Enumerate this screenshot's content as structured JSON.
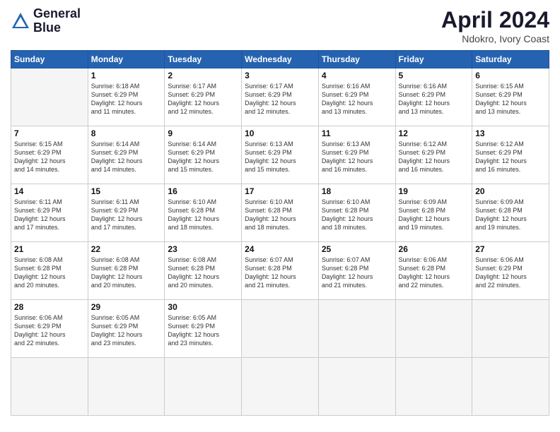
{
  "logo": {
    "line1": "General",
    "line2": "Blue"
  },
  "title": "April 2024",
  "location": "Ndokro, Ivory Coast",
  "days": [
    "Sunday",
    "Monday",
    "Tuesday",
    "Wednesday",
    "Thursday",
    "Friday",
    "Saturday"
  ],
  "cells": [
    {
      "date": "",
      "info": ""
    },
    {
      "date": "1",
      "info": "Sunrise: 6:18 AM\nSunset: 6:29 PM\nDaylight: 12 hours\nand 11 minutes."
    },
    {
      "date": "2",
      "info": "Sunrise: 6:17 AM\nSunset: 6:29 PM\nDaylight: 12 hours\nand 12 minutes."
    },
    {
      "date": "3",
      "info": "Sunrise: 6:17 AM\nSunset: 6:29 PM\nDaylight: 12 hours\nand 12 minutes."
    },
    {
      "date": "4",
      "info": "Sunrise: 6:16 AM\nSunset: 6:29 PM\nDaylight: 12 hours\nand 13 minutes."
    },
    {
      "date": "5",
      "info": "Sunrise: 6:16 AM\nSunset: 6:29 PM\nDaylight: 12 hours\nand 13 minutes."
    },
    {
      "date": "6",
      "info": "Sunrise: 6:15 AM\nSunset: 6:29 PM\nDaylight: 12 hours\nand 13 minutes."
    },
    {
      "date": "7",
      "info": "Sunrise: 6:15 AM\nSunset: 6:29 PM\nDaylight: 12 hours\nand 14 minutes."
    },
    {
      "date": "8",
      "info": "Sunrise: 6:14 AM\nSunset: 6:29 PM\nDaylight: 12 hours\nand 14 minutes."
    },
    {
      "date": "9",
      "info": "Sunrise: 6:14 AM\nSunset: 6:29 PM\nDaylight: 12 hours\nand 15 minutes."
    },
    {
      "date": "10",
      "info": "Sunrise: 6:13 AM\nSunset: 6:29 PM\nDaylight: 12 hours\nand 15 minutes."
    },
    {
      "date": "11",
      "info": "Sunrise: 6:13 AM\nSunset: 6:29 PM\nDaylight: 12 hours\nand 16 minutes."
    },
    {
      "date": "12",
      "info": "Sunrise: 6:12 AM\nSunset: 6:29 PM\nDaylight: 12 hours\nand 16 minutes."
    },
    {
      "date": "13",
      "info": "Sunrise: 6:12 AM\nSunset: 6:29 PM\nDaylight: 12 hours\nand 16 minutes."
    },
    {
      "date": "14",
      "info": "Sunrise: 6:11 AM\nSunset: 6:29 PM\nDaylight: 12 hours\nand 17 minutes."
    },
    {
      "date": "15",
      "info": "Sunrise: 6:11 AM\nSunset: 6:29 PM\nDaylight: 12 hours\nand 17 minutes."
    },
    {
      "date": "16",
      "info": "Sunrise: 6:10 AM\nSunset: 6:28 PM\nDaylight: 12 hours\nand 18 minutes."
    },
    {
      "date": "17",
      "info": "Sunrise: 6:10 AM\nSunset: 6:28 PM\nDaylight: 12 hours\nand 18 minutes."
    },
    {
      "date": "18",
      "info": "Sunrise: 6:10 AM\nSunset: 6:28 PM\nDaylight: 12 hours\nand 18 minutes."
    },
    {
      "date": "19",
      "info": "Sunrise: 6:09 AM\nSunset: 6:28 PM\nDaylight: 12 hours\nand 19 minutes."
    },
    {
      "date": "20",
      "info": "Sunrise: 6:09 AM\nSunset: 6:28 PM\nDaylight: 12 hours\nand 19 minutes."
    },
    {
      "date": "21",
      "info": "Sunrise: 6:08 AM\nSunset: 6:28 PM\nDaylight: 12 hours\nand 20 minutes."
    },
    {
      "date": "22",
      "info": "Sunrise: 6:08 AM\nSunset: 6:28 PM\nDaylight: 12 hours\nand 20 minutes."
    },
    {
      "date": "23",
      "info": "Sunrise: 6:08 AM\nSunset: 6:28 PM\nDaylight: 12 hours\nand 20 minutes."
    },
    {
      "date": "24",
      "info": "Sunrise: 6:07 AM\nSunset: 6:28 PM\nDaylight: 12 hours\nand 21 minutes."
    },
    {
      "date": "25",
      "info": "Sunrise: 6:07 AM\nSunset: 6:28 PM\nDaylight: 12 hours\nand 21 minutes."
    },
    {
      "date": "26",
      "info": "Sunrise: 6:06 AM\nSunset: 6:28 PM\nDaylight: 12 hours\nand 22 minutes."
    },
    {
      "date": "27",
      "info": "Sunrise: 6:06 AM\nSunset: 6:29 PM\nDaylight: 12 hours\nand 22 minutes."
    },
    {
      "date": "28",
      "info": "Sunrise: 6:06 AM\nSunset: 6:29 PM\nDaylight: 12 hours\nand 22 minutes."
    },
    {
      "date": "29",
      "info": "Sunrise: 6:05 AM\nSunset: 6:29 PM\nDaylight: 12 hours\nand 23 minutes."
    },
    {
      "date": "30",
      "info": "Sunrise: 6:05 AM\nSunset: 6:29 PM\nDaylight: 12 hours\nand 23 minutes."
    },
    {
      "date": "",
      "info": ""
    },
    {
      "date": "",
      "info": ""
    },
    {
      "date": "",
      "info": ""
    },
    {
      "date": "",
      "info": ""
    }
  ]
}
